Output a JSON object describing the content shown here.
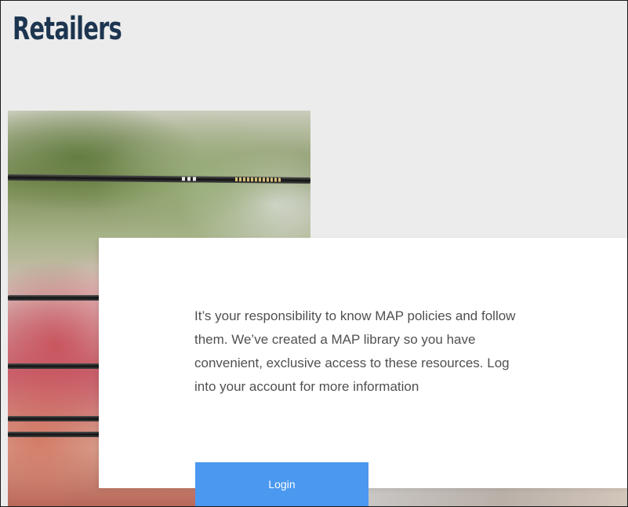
{
  "page": {
    "title": "Retailers"
  },
  "hero": {
    "image": "archery-arrows-photo"
  },
  "card": {
    "message": "It’s your responsibility to know MAP policies and follow them. We’ve created a MAP library so you have convenient, exclusive access to these resources. Log into your account for more information",
    "login_label": "Login"
  },
  "colors": {
    "title": "#1c3550",
    "background": "#ececec",
    "button": "#4a98f0",
    "body_text": "#505050"
  }
}
